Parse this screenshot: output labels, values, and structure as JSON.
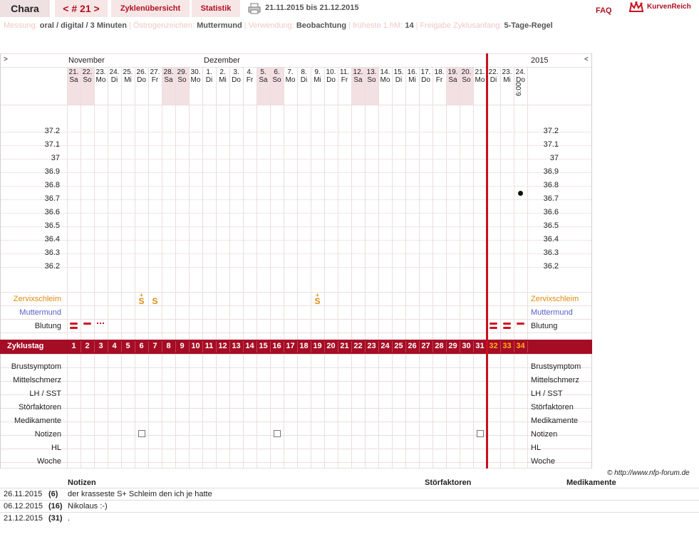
{
  "header": {
    "name": "Chara",
    "cycle": "< # 21 >",
    "overview": "Zyklenübersicht",
    "stats": "Statistik",
    "range": "21.11.2015 bis 21.12.2015",
    "faq": "FAQ",
    "logo": "KurvenReich"
  },
  "settings": [
    {
      "k": "Messung:",
      "v": "oral / digital / 3 Minuten"
    },
    {
      "k": "Östrogenzeichen:",
      "v": "Muttermund"
    },
    {
      "k": "Verwendung:",
      "v": "Beobachtung"
    },
    {
      "k": "früheste 1.hM:",
      "v": "14"
    },
    {
      "k": "Freigabe Zyklusanfang:",
      "v": "5-Tage-Regel"
    }
  ],
  "chart": {
    "nav_left": ">",
    "nav_right": "<",
    "months": [
      "November",
      "Dezember",
      "2015"
    ],
    "days": [
      {
        "d": "21.",
        "w": "Sa"
      },
      {
        "d": "22.",
        "w": "So"
      },
      {
        "d": "23.",
        "w": "Mo"
      },
      {
        "d": "24.",
        "w": "Di"
      },
      {
        "d": "25.",
        "w": "Mi"
      },
      {
        "d": "26.",
        "w": "Do"
      },
      {
        "d": "27.",
        "w": "Fr"
      },
      {
        "d": "28.",
        "w": "Sa"
      },
      {
        "d": "29.",
        "w": "So"
      },
      {
        "d": "30.",
        "w": "Mo"
      },
      {
        "d": "1.",
        "w": "Di"
      },
      {
        "d": "2.",
        "w": "Mi"
      },
      {
        "d": "3.",
        "w": "Do"
      },
      {
        "d": "4.",
        "w": "Fr"
      },
      {
        "d": "5.",
        "w": "Sa"
      },
      {
        "d": "6.",
        "w": "So"
      },
      {
        "d": "7.",
        "w": "Mo"
      },
      {
        "d": "8.",
        "w": "Di"
      },
      {
        "d": "9.",
        "w": "Mi"
      },
      {
        "d": "10.",
        "w": "Do"
      },
      {
        "d": "11.",
        "w": "Fr"
      },
      {
        "d": "12.",
        "w": "Sa"
      },
      {
        "d": "13.",
        "w": "So"
      },
      {
        "d": "14.",
        "w": "Mo"
      },
      {
        "d": "15.",
        "w": "Di"
      },
      {
        "d": "16.",
        "w": "Mi"
      },
      {
        "d": "17.",
        "w": "Do"
      },
      {
        "d": "18.",
        "w": "Fr"
      },
      {
        "d": "19.",
        "w": "Sa"
      },
      {
        "d": "20.",
        "w": "So"
      },
      {
        "d": "21.",
        "w": "Mo"
      },
      {
        "d": "22.",
        "w": "Di"
      },
      {
        "d": "23.",
        "w": "Mi"
      },
      {
        "d": "24.",
        "w": "Do"
      }
    ],
    "last_time": "6:00",
    "temps": [
      "37.2",
      "37.1",
      "37",
      "36.9",
      "36.8",
      "36.7",
      "36.6",
      "36.5",
      "36.4",
      "36.3",
      "36.2"
    ],
    "reading": {
      "day": 34,
      "temp": 36.75
    },
    "rows": {
      "zervix": "Zervixschleim",
      "mumu": "Muttermund",
      "blutung": "Blutung",
      "zyklustag": "Zyklustag",
      "brust": "Brustsymptom",
      "mittel": "Mittelschmerz",
      "lh": "LH / SST",
      "stoer": "Störfaktoren",
      "medi": "Medikamente",
      "notizen": "Notizen",
      "hl": "HL",
      "woche": "Woche"
    },
    "zervix_marks": [
      {
        "day": 6,
        "sym": "S+"
      },
      {
        "day": 7,
        "sym": "S"
      },
      {
        "day": 19,
        "sym": "S+"
      }
    ],
    "blood_marks": [
      {
        "day": 1,
        "level": "heavy"
      },
      {
        "day": 2,
        "level": "medium"
      },
      {
        "day": 3,
        "level": "spotting"
      },
      {
        "day": 32,
        "level": "heavy"
      },
      {
        "day": 33,
        "level": "heavy"
      },
      {
        "day": 34,
        "level": "medium"
      }
    ],
    "note_days": [
      6,
      16,
      31
    ]
  },
  "notes": {
    "copyright": "© http://www.nfp-forum.de",
    "headers": {
      "notizen": "Notizen",
      "stoer": "Störfaktoren",
      "medi": "Medikamente"
    },
    "rows": [
      {
        "date": "26.11.2015",
        "day": "(6)",
        "text": "der krasseste S+ Schleim den ich je hatte"
      },
      {
        "date": "06.12.2015",
        "day": "(16)",
        "text": "Nikolaus :-)"
      },
      {
        "date": "21.12.2015",
        "day": "(31)",
        "text": "."
      }
    ]
  },
  "colors": {
    "accent": "#a50d25",
    "pink": "#f6e6e6",
    "zervix": "#e08a10",
    "mumu": "#5560c8"
  }
}
